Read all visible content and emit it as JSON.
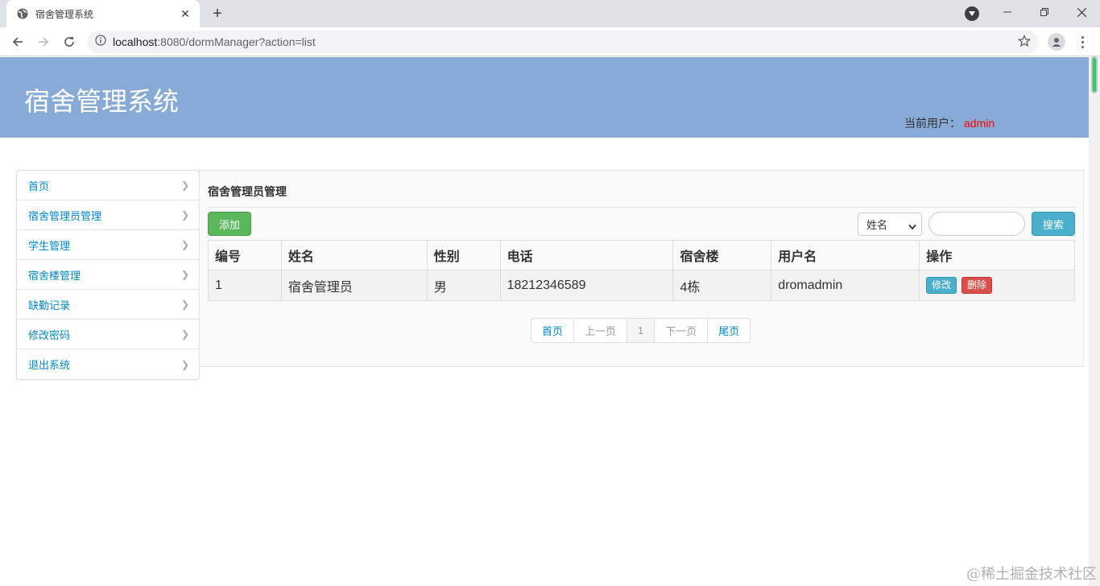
{
  "browser": {
    "tab_title": "宿舍管理系统",
    "url_host": "localhost",
    "url_rest": ":8080/dormManager?action=list"
  },
  "header": {
    "brand": "宿舍管理系统",
    "user_label": "当前用户：",
    "user_name": "admin"
  },
  "sidebar": {
    "items": [
      {
        "label": "首页"
      },
      {
        "label": "宿舍管理员管理"
      },
      {
        "label": "学生管理"
      },
      {
        "label": "宿舍楼管理"
      },
      {
        "label": "缺勤记录"
      },
      {
        "label": "修改密码"
      },
      {
        "label": "退出系统"
      }
    ]
  },
  "main": {
    "title": "宿舍管理员管理",
    "add_label": "添加",
    "search_field_selected": "姓名",
    "search_value": "",
    "search_label": "搜索",
    "columns": [
      "编号",
      "姓名",
      "性别",
      "电话",
      "宿舍楼",
      "用户名",
      "操作"
    ],
    "rows": [
      {
        "id": "1",
        "name": "宿舍管理员",
        "gender": "男",
        "phone": "18212346589",
        "building": "4栋",
        "username": "dromadmin"
      }
    ],
    "row_actions": {
      "edit": "修改",
      "delete": "删除"
    },
    "pager": {
      "first": "首页",
      "prev": "上一页",
      "current": "1",
      "next": "下一页",
      "last": "尾页"
    }
  },
  "watermark": "@稀土掘金技术社区",
  "colors": {
    "header_bg": "#88aad7",
    "add_button": "#5bb75b",
    "search_button": "#49afcd",
    "delete_button": "#da4f49",
    "user_name": "#ff0000",
    "link": "#0088cc"
  }
}
